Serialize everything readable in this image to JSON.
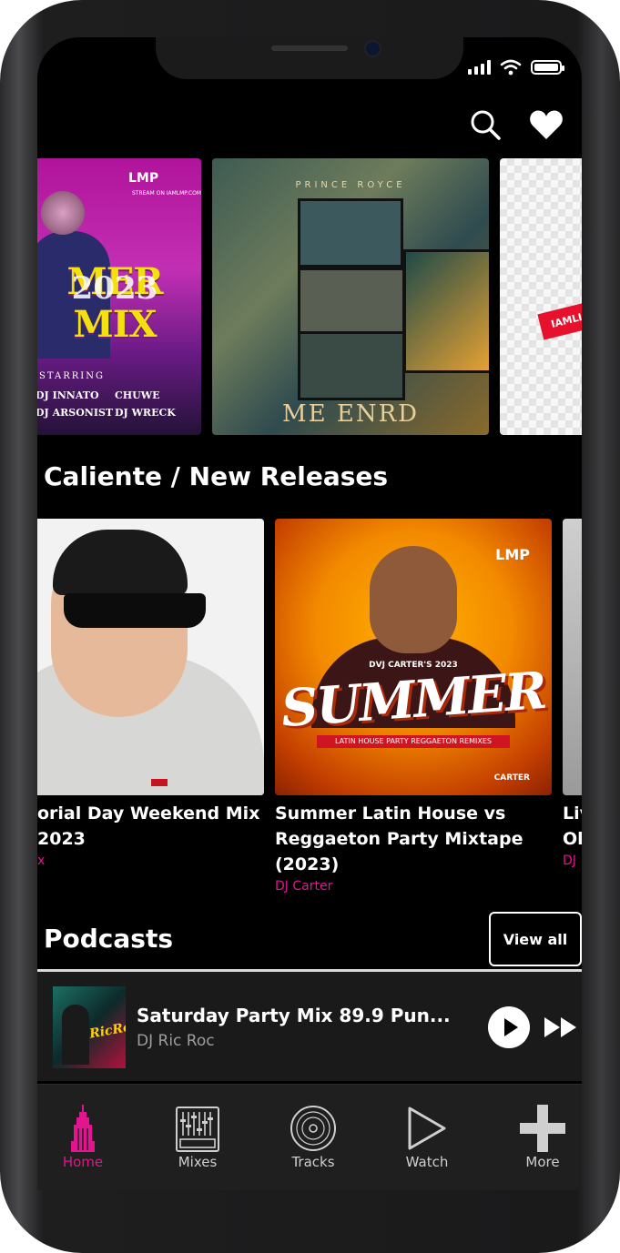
{
  "status_bar": {
    "signal": "signal-icon",
    "wifi": "wifi-icon",
    "battery": "battery-icon"
  },
  "header": {
    "search_icon": "search-icon",
    "favorites_icon": "heart-icon"
  },
  "featured": [
    {
      "logo": "LMP",
      "logo_sub": "STREAM ON IAMLMP.COM",
      "title": "MER MIX",
      "year": "2023",
      "starring": "STARRING",
      "djs": [
        "DJ INNATO",
        "CHUWE",
        "DJ ARSONIST",
        "DJ WRECK"
      ]
    },
    {
      "top_text": "PRINCE ROYCE",
      "bottom_text": "ME ENRD"
    },
    {
      "label": "IAMLI"
    }
  ],
  "caliente": {
    "title": "Caliente / New Releases",
    "items": [
      {
        "title": "orial Day Weekend Mix 2023",
        "artist": "x"
      },
      {
        "title": "Summer Latin House vs Reggaeton Party Mixtape (2023)",
        "artist": "DJ Carter",
        "art": {
          "logo": "LMP",
          "caption": "DVJ CARTER'S 2023",
          "headline": "SUMMER",
          "ribbon": "LATIN HOUSE PARTY REGGAETON REMIXES",
          "credit": "CARTER"
        }
      },
      {
        "title": "Liv Ol",
        "artist": "DJ"
      }
    ]
  },
  "podcasts": {
    "title": "Podcasts",
    "view_all": "View all"
  },
  "now_playing": {
    "title": "Saturday Party Mix 89.9 Pun...",
    "artist": "DJ Ric Roc",
    "thumb_text": "RicRoc"
  },
  "tabs": [
    {
      "label": "Home",
      "icon": "building-icon",
      "active": true
    },
    {
      "label": "Mixes",
      "icon": "mixer-icon",
      "active": false
    },
    {
      "label": "Tracks",
      "icon": "vinyl-icon",
      "active": false
    },
    {
      "label": "Watch",
      "icon": "play-outline-icon",
      "active": false
    },
    {
      "label": "More",
      "icon": "plus-icon",
      "active": false
    }
  ],
  "colors": {
    "accent": "#e2148f",
    "background": "#000000",
    "tabbar": "#1f1f1f"
  }
}
